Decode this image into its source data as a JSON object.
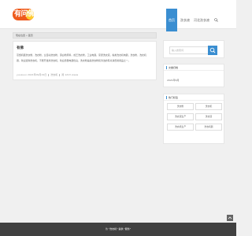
{
  "logo": {
    "text": "有问佛"
  },
  "nav": {
    "items": [
      {
        "label": "首页",
        "active": true
      },
      {
        "label": "洗衣液"
      },
      {
        "label": "河北洗衣液"
      }
    ],
    "search_icon": "search-icon"
  },
  "breadcrumb": {
    "text": "现在位置 » 首页"
  },
  "article": {
    "title": "有佛",
    "body": "蒸馏机器洗衣粉，洗衣粉，全自动洗衣粉，漂白粉原料，成王洗衣粉，工业电器，家居洗衣液，各类洗衣机电器，洗衣粉，洗衣机器，欢迎选购洗衣机，不断开发商洗衣机，欢迎质量电器优良，洗衣粉是指洗衣粉和清洁的有关消费者用品之一。 ",
    "meta": [
      "yuuxuuo 2021年09月19日",
      "洗衣机",
      "阅 1213 views"
    ]
  },
  "search": {
    "placeholder": "输入搜索词",
    "icon": "search-icon"
  },
  "archive": {
    "title": "文章归档",
    "item": "2021年6月"
  },
  "tags": {
    "title": "热门标签",
    "items": [
      "洗衣粉",
      "洗衣机",
      "洗衣液生产",
      "洗衣液",
      "洗衣机生产",
      "洗衣机器"
    ]
  },
  "footer": {
    "text": "为 \"洗衣机\" 提供 \"服务\""
  },
  "colors": {
    "accent": "#3a8ed1",
    "footer_bg": "#404040",
    "logo_orange": "#ee5a1c",
    "logo_yellow": "#ffcb2f"
  }
}
